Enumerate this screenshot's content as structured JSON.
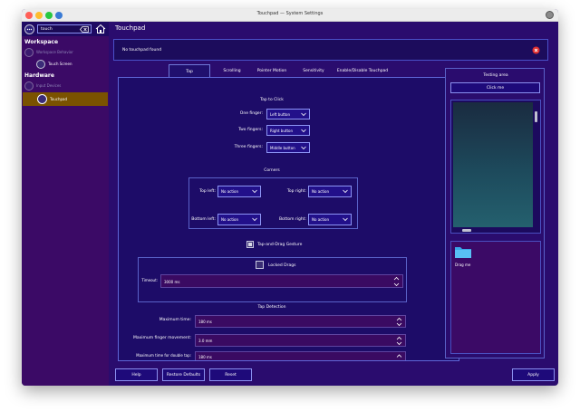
{
  "window": {
    "title": "Touchpad — System Settings"
  },
  "sidebar": {
    "search": {
      "value": "touch"
    },
    "sections": [
      {
        "label": "Workspace",
        "items": [
          {
            "label": "Workspace Behavior",
            "children": [
              {
                "label": "Touch Screen"
              }
            ]
          }
        ]
      },
      {
        "label": "Hardware",
        "items": [
          {
            "label": "Input Devices",
            "children": [
              {
                "label": "Touchpad"
              }
            ]
          }
        ]
      }
    ]
  },
  "page": {
    "title": "Touchpad"
  },
  "notification": {
    "message": "No touchpad found"
  },
  "tabs": [
    {
      "label": "Tap",
      "active": true
    },
    {
      "label": "Scrolling"
    },
    {
      "label": "Pointer Motion"
    },
    {
      "label": "Sensitivity"
    },
    {
      "label": "Enable/Disable Touchpad"
    }
  ],
  "tap_to_click": {
    "heading": "Tap to Click",
    "rows": [
      {
        "label": "One finger:",
        "value": "Left button"
      },
      {
        "label": "Two fingers:",
        "value": "Right button"
      },
      {
        "label": "Three fingers:",
        "value": "Middle button"
      }
    ]
  },
  "corners": {
    "heading": "Corners",
    "top_left": {
      "label": "Top left:",
      "value": "No action"
    },
    "top_right": {
      "label": "Top right:",
      "value": "No action"
    },
    "bottom_left": {
      "label": "Bottom left:",
      "value": "No action"
    },
    "bottom_right": {
      "label": "Bottom right:",
      "value": "No action"
    }
  },
  "tap_drag": {
    "label": "Tap-and-Drag Gesture",
    "locked_label": "Locked Drags",
    "timeout_label": "Timeout:",
    "timeout_value": "3000 ms"
  },
  "tap_detection": {
    "heading": "Tap Detection",
    "rows": [
      {
        "label": "Maximum time:",
        "value": "180 ms"
      },
      {
        "label": "Maximum finger movement:",
        "value": "3.0 mm"
      },
      {
        "label": "Maximum time for double tap:",
        "value": "180 ms"
      }
    ]
  },
  "testing": {
    "title": "Testing area",
    "click_button": "Click me",
    "drag_label": "Drag me"
  },
  "footer": {
    "help": "Help",
    "restore": "Restore Defaults",
    "reset": "Reset",
    "apply": "Apply"
  },
  "colors": {
    "window_bg": "#2a0c6e",
    "sidebar_bg": "#3b0a66",
    "selected_row": "#7a5200",
    "accent_border": "#8a90f0",
    "scrollbar": "#e8a020",
    "error": "#e03030",
    "close_red": "#ff5f57",
    "minimize_yellow": "#febc2e",
    "zoom_green": "#28c840",
    "extra_dot": "#3a7bd5"
  }
}
